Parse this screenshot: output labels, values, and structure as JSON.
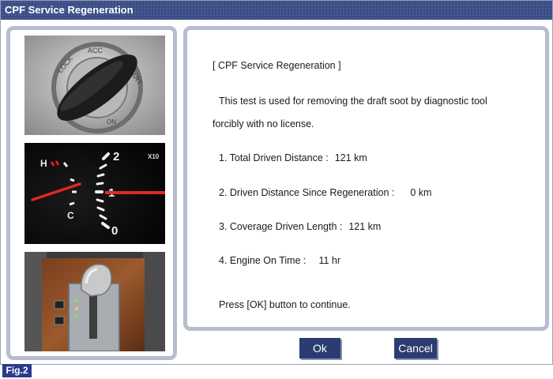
{
  "window": {
    "title": "CPF Service Regeneration"
  },
  "content": {
    "heading": "[ CPF Service Regeneration ]",
    "description_line1": "This test is used for removing the draft soot by diagnostic tool",
    "description_line2": "forcibly with no license.",
    "items": [
      {
        "label": "1. Total Driven Distance :",
        "value": "121 km"
      },
      {
        "label": "2. Driven Distance Since Regeneration :",
        "value": "0 km"
      },
      {
        "label": "3. Coverage Driven Length :",
        "value": "121 km"
      },
      {
        "label": "4. Engine On Time :",
        "value": "11 hr"
      }
    ],
    "prompt": "Press [OK] button to continue."
  },
  "buttons": {
    "ok_label": "Ok",
    "cancel_label": "Cancel"
  },
  "images": {
    "ignition_key": {
      "texts": [
        "LOCK",
        "ACC",
        "START",
        "ON"
      ]
    },
    "gauge": {
      "texts": [
        "H",
        "C",
        "2",
        "1",
        "0",
        "X10"
      ]
    },
    "shifter": {}
  },
  "figure_label": "Fig.2",
  "colors": {
    "titlebar": "#3a4d86",
    "panel_border": "#b7bdd0",
    "button": "#2c3c72",
    "figure_label": "#2a3b8f"
  }
}
